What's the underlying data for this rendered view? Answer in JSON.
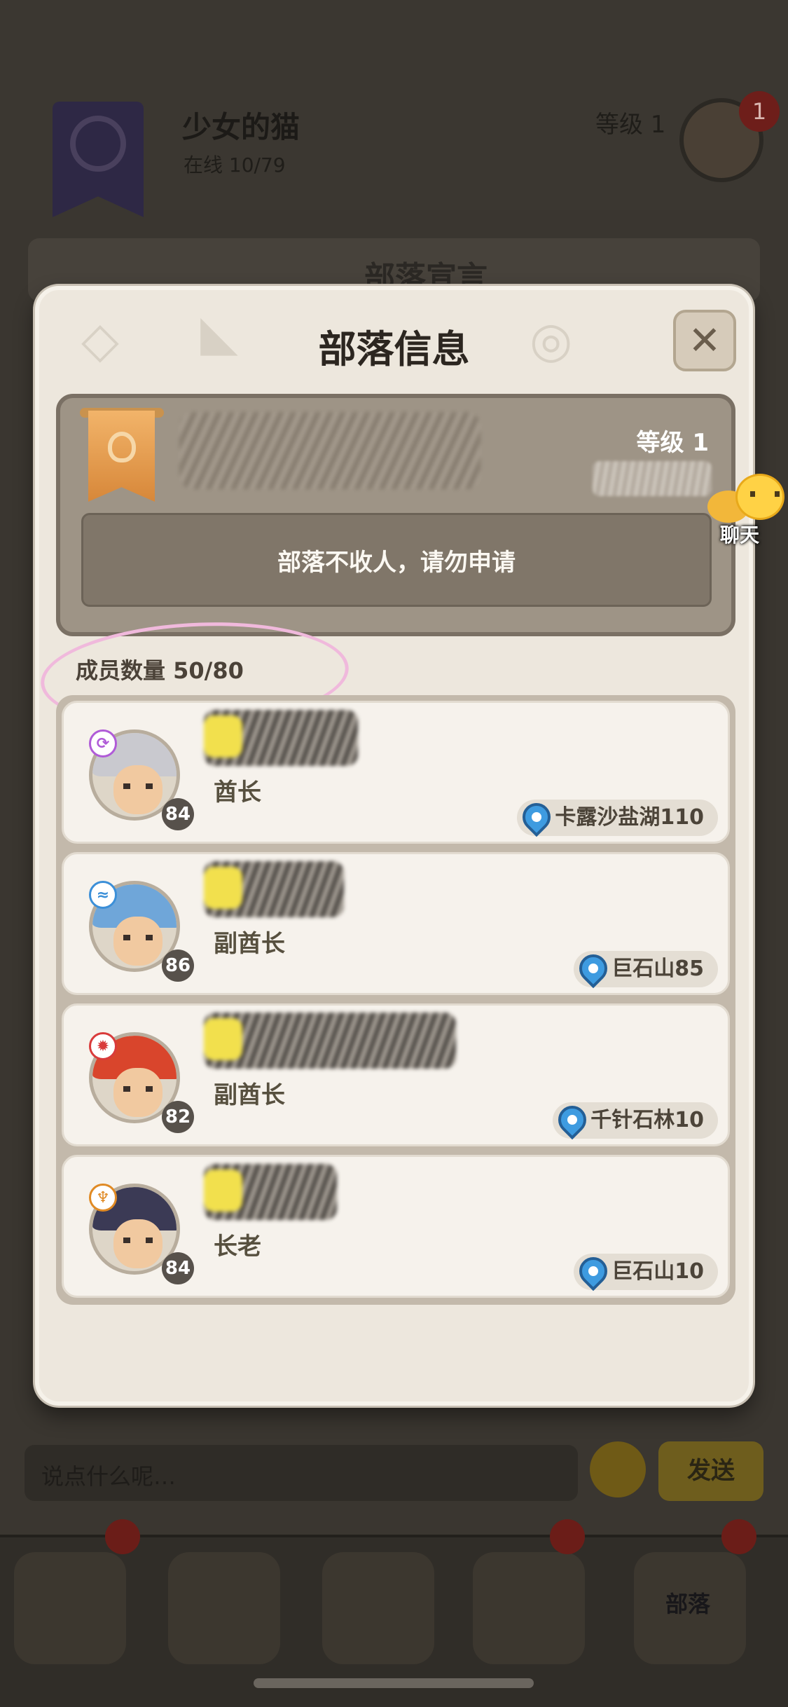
{
  "background": {
    "tribe_name": "少女的猫",
    "online": "在线 10/79",
    "level": "等级 1",
    "avatar_badge": "1",
    "notice_title": "部落宣言",
    "chat_placeholder": "说点什么呢…",
    "send_label": "发送",
    "tab_tribe_label": "部落"
  },
  "modal": {
    "title": "部落信息",
    "close_icon": "close-x",
    "info": {
      "level": "等级 1",
      "notice": "部落不收人，请勿申请"
    },
    "member_count_label": "成员数量 50/80",
    "members": [
      {
        "role": "酋长",
        "level": "84",
        "location": "卡露沙盐湖110",
        "hair": "#c9c9cf",
        "element": "#b05bd8",
        "element_glyph": "⟳"
      },
      {
        "role": "副酋长",
        "level": "86",
        "location": "巨石山85",
        "hair": "#6fa6d9",
        "element": "#3b8fd8",
        "element_glyph": "≈"
      },
      {
        "role": "副酋长",
        "level": "82",
        "location": "千针石林10",
        "hair": "#d9452c",
        "element": "#d93b3b",
        "element_glyph": "✹"
      },
      {
        "role": "长老",
        "level": "84",
        "location": "巨石山10",
        "hair": "#3b3a55",
        "element": "#e08a24",
        "element_glyph": "♆"
      }
    ]
  },
  "chat_float": {
    "label": "聊天"
  },
  "colors": {
    "modal_bg": "#ede7dd",
    "info_card": "#9e9486",
    "pin": "#3e9be0",
    "highlight": "#f0b9dc"
  }
}
